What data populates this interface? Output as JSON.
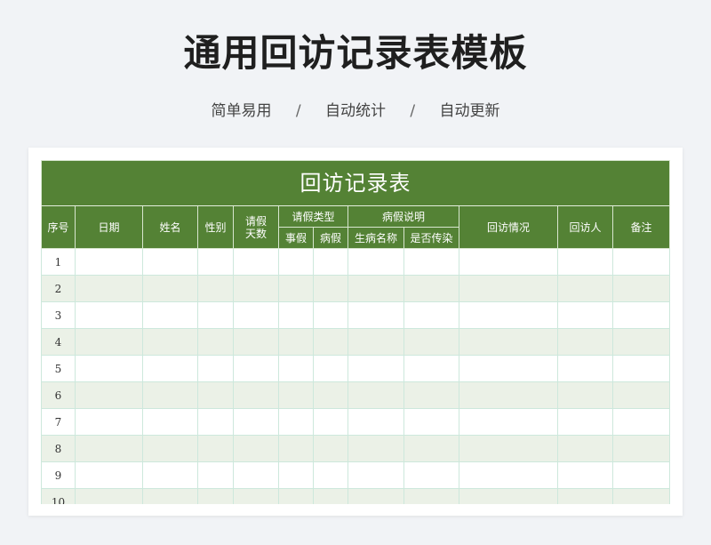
{
  "header": {
    "title": "通用回访记录表模板",
    "features": [
      "简单易用",
      "自动统计",
      "自动更新"
    ],
    "separator": "/"
  },
  "sheet": {
    "title": "回访记录表",
    "columns": {
      "index": "序号",
      "date": "日期",
      "name": "姓名",
      "gender": "性别",
      "leave_days": [
        "请假",
        "天数"
      ],
      "leave_type": "请假类型",
      "personal_leave": "事假",
      "sick_leave": "病假",
      "sick_note": "病假说明",
      "illness_name": "生病名称",
      "contagious": "是否传染",
      "visit_status": "回访情况",
      "visitor": "回访人",
      "remarks": "备注"
    },
    "rows": [
      1,
      2,
      3,
      4,
      5,
      6,
      7,
      8,
      9,
      10
    ]
  },
  "colors": {
    "header_green": "#548235",
    "alt_row": "#ebf1e7",
    "grid_line": "#cde8dc",
    "page_bg": "#f1f3f6"
  }
}
